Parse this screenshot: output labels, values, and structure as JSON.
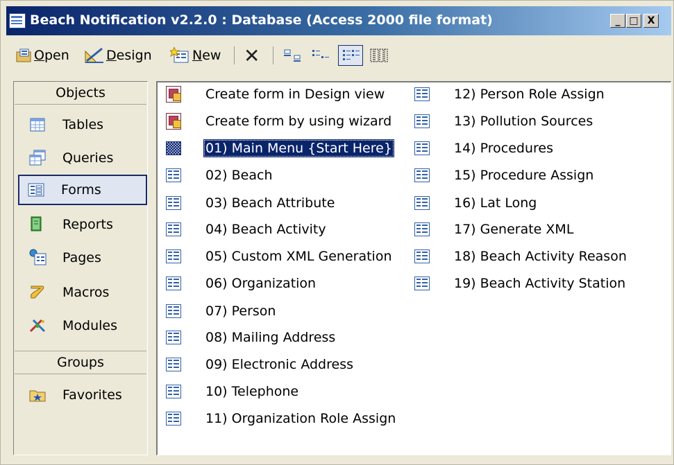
{
  "window": {
    "title": "Beach Notification v2.2.0 : Database (Access 2000 file format)",
    "controls": {
      "minimize": "_",
      "maximize": "□",
      "close": "X"
    }
  },
  "toolbar": {
    "open_prefix": "",
    "open_u": "O",
    "open_rest": "pen",
    "design_u": "D",
    "design_rest": "esign",
    "new_u": "N",
    "new_rest": "ew",
    "delete": "✕"
  },
  "objects_bar": {
    "objects_header": "Objects",
    "groups_header": "Groups",
    "items": [
      {
        "label": "Tables",
        "icon": "table-icon"
      },
      {
        "label": "Queries",
        "icon": "query-icon"
      },
      {
        "label": "Forms",
        "icon": "form-icon",
        "selected": true
      },
      {
        "label": "Reports",
        "icon": "report-icon"
      },
      {
        "label": "Pages",
        "icon": "page-icon"
      },
      {
        "label": "Macros",
        "icon": "macro-icon"
      },
      {
        "label": "Modules",
        "icon": "module-icon"
      }
    ],
    "groups": [
      {
        "label": "Favorites",
        "icon": "favorites-folder-icon"
      }
    ]
  },
  "list": {
    "column1": [
      {
        "label": "Create form in Design view",
        "icon": "shortcut-icon"
      },
      {
        "label": "Create form by using wizard",
        "icon": "shortcut-icon"
      },
      {
        "label": "01) Main Menu {Start Here}",
        "icon": "switchboard-icon",
        "selected": true
      },
      {
        "label": "02) Beach",
        "icon": "form-icon"
      },
      {
        "label": "03) Beach Attribute",
        "icon": "form-icon"
      },
      {
        "label": "04) Beach Activity",
        "icon": "form-icon"
      },
      {
        "label": "05) Custom XML Generation",
        "icon": "form-icon"
      },
      {
        "label": "06) Organization",
        "icon": "form-icon"
      },
      {
        "label": "07) Person",
        "icon": "form-icon"
      },
      {
        "label": "08) Mailing Address",
        "icon": "form-icon"
      },
      {
        "label": "09) Electronic Address",
        "icon": "form-icon"
      },
      {
        "label": "10) Telephone",
        "icon": "form-icon"
      },
      {
        "label": "11) Organization Role Assign",
        "icon": "form-icon"
      }
    ],
    "column2": [
      {
        "label": "12) Person Role Assign",
        "icon": "form-icon"
      },
      {
        "label": "13) Pollution Sources",
        "icon": "form-icon"
      },
      {
        "label": "14) Procedures",
        "icon": "form-icon"
      },
      {
        "label": "15) Procedure Assign",
        "icon": "form-icon"
      },
      {
        "label": "16) Lat Long",
        "icon": "form-icon"
      },
      {
        "label": "17) Generate XML",
        "icon": "form-icon"
      },
      {
        "label": "18) Beach Activity Reason",
        "icon": "form-icon"
      },
      {
        "label": "19) Beach Activity Station",
        "icon": "form-icon"
      }
    ]
  }
}
